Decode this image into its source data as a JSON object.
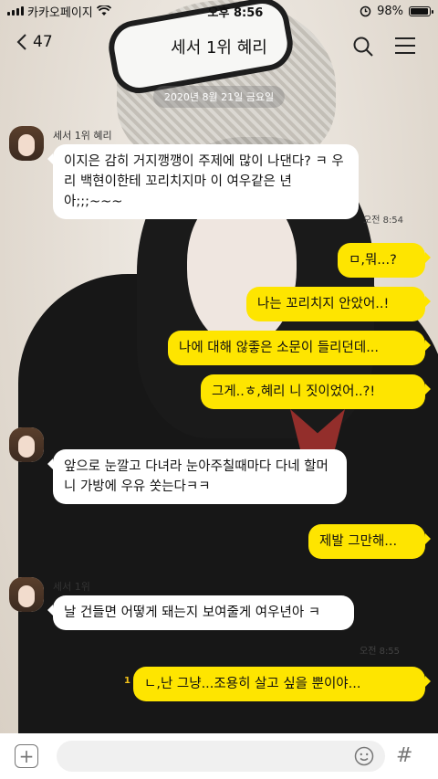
{
  "status_bar": {
    "carrier": "카카오페이지",
    "time": "오후 8:56",
    "battery": "98%",
    "battery_level": 0.98
  },
  "header": {
    "back_count": "47",
    "title": "세서 1위 혜리"
  },
  "date_divider": "2020년 8월 21일 금요일",
  "messages": [
    {
      "dir": "in",
      "sender": "세서 1위 혜리",
      "text": "이지은 감히 거지깽깽이 주제에 많이 나댄다? ㅋ 우리 백현이한테 꼬리치지마 이 여우같은 년아;;;~~~",
      "time": "오전 8:54"
    },
    {
      "dir": "out",
      "text": "ㅁ,뭐...?"
    },
    {
      "dir": "out",
      "text": "나는 꼬리치지 안았어..!"
    },
    {
      "dir": "out",
      "text": "나에 대해 않좋은 소문이 들리던데..."
    },
    {
      "dir": "out",
      "text": "그게..ㅎ,혜리 니 짓이었어..?!"
    },
    {
      "dir": "in",
      "text": "앞으로 눈깔고 다녀라 눈아주칠때마다 다네 할머니 가방에 우유 쏫는다ㅋㅋ"
    },
    {
      "dir": "out",
      "text": "제발 그만해..."
    },
    {
      "dir": "in",
      "sender": "세서 1위",
      "text": "날 건들면 어떻게 돼는지 보여줄게 여우년아 ㅋ",
      "time": "오전 8:55"
    },
    {
      "dir": "out",
      "unread": "1",
      "text": "ㄴ,난 그냥...조용히 살고 싶을 뿐이야..."
    }
  ],
  "input": {
    "placeholder": ""
  },
  "icons": [
    "signal-icon",
    "wifi-icon",
    "alarm-icon",
    "battery-icon",
    "back-chevron-icon",
    "search-icon",
    "menu-icon",
    "plus-icon",
    "emoji-icon",
    "hash-icon"
  ],
  "colors": {
    "my_bubble": "#fee500",
    "their_bubble": "#ffffff",
    "status_text": "#111111"
  }
}
